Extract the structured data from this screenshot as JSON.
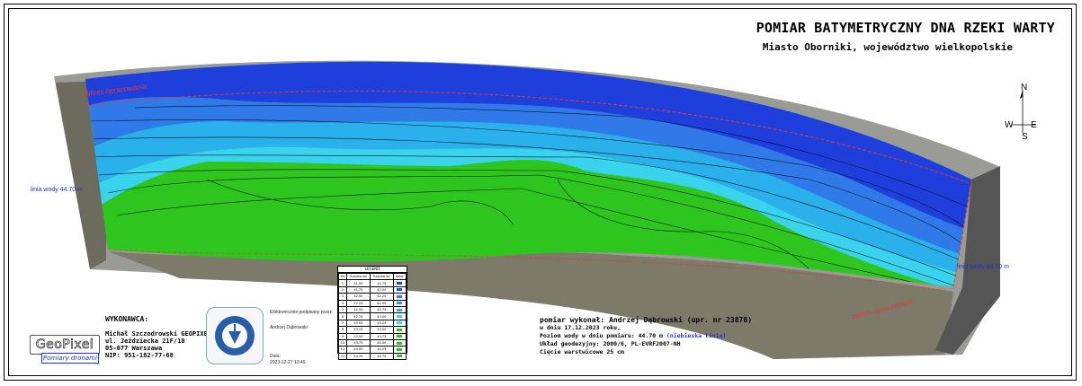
{
  "header": {
    "title": "POMIAR BATYMETRYCZNY DNA RZEKI WARTY",
    "subtitle": "Miasto Oborniki, województwo wielkopolskie"
  },
  "compass": {
    "n": "N",
    "s": "S",
    "e": "E",
    "w": "W"
  },
  "map": {
    "water_line_left": "linia wody 44.70 m",
    "water_line_right": "linia wody 44.70 m",
    "extent_top": "zakres opracowania",
    "extent_bottom": "zakres opracowania",
    "colors": {
      "deep": "#1f3fdc",
      "mid": "#2f7ae8",
      "light": "#2ab0ea",
      "cyan": "#39d3ee",
      "shallow": "#2ec51f",
      "bank": "#8a8a84"
    }
  },
  "contractor": {
    "heading": "WYKONAWCA:",
    "lines": [
      "Michał Szczodrowski GEOPIXEL",
      "ul. Jeździecka 21F/10",
      "05-077 Warszawa",
      "NIP: 951-182-77-68"
    ],
    "logo_text": "GeoPixel",
    "logo_sub": "Pomiary dronami"
  },
  "signature": {
    "label": "Elektronicznie podpisany przez:",
    "name": "Andrzej Dąbrowski",
    "date_label": "Data:",
    "date": "2023-12-27 13:49"
  },
  "legend": {
    "title": "LEGEND",
    "headers": [
      "Nr",
      "Rzędna od",
      "Rzędna do",
      "Kolor"
    ],
    "rows": [
      {
        "nr": "1",
        "from": "41.50",
        "to": "41.75",
        "color": "#1f3fdc"
      },
      {
        "nr": "2",
        "from": "41.75",
        "to": "42.00",
        "color": "#2550e0"
      },
      {
        "nr": "3",
        "from": "42.00",
        "to": "42.25",
        "color": "#2f7ae8"
      },
      {
        "nr": "4",
        "from": "42.25",
        "to": "42.50",
        "color": "#2a95ea"
      },
      {
        "nr": "5",
        "from": "42.50",
        "to": "42.75",
        "color": "#2ab0ea"
      },
      {
        "nr": "6",
        "from": "42.75",
        "to": "43.00",
        "color": "#39d3ee"
      },
      {
        "nr": "7",
        "from": "43.00",
        "to": "43.25",
        "color": "#3fe0d0"
      },
      {
        "nr": "8",
        "from": "43.25",
        "to": "43.50",
        "color": "#2ec51f"
      },
      {
        "nr": "9",
        "from": "43.50",
        "to": "43.75",
        "color": "#2ec51f"
      },
      {
        "nr": "10",
        "from": "43.75",
        "to": "44.00",
        "color": "#2ec51f"
      },
      {
        "nr": "11",
        "from": "44.00",
        "to": "44.25",
        "color": "#2ec51f"
      },
      {
        "nr": "12",
        "from": "44.25",
        "to": "44.70",
        "color": "#2ec51f"
      }
    ]
  },
  "survey": {
    "performed": "pomiar wykonał: Andrzej Dąbrowski (upr. nr 23878)",
    "date": "w dniu 17.12.2023 roku,",
    "water_level_prefix": "Poziom wody w dniu pomiaru: 44.70 m",
    "water_level_note": "(niebieska linia)",
    "coordinate_system": "Układ geodezyjny: 2000/6, PL-EVRF2007-NH",
    "contour_interval": "Cięcie warstwicowe 25 cm"
  }
}
